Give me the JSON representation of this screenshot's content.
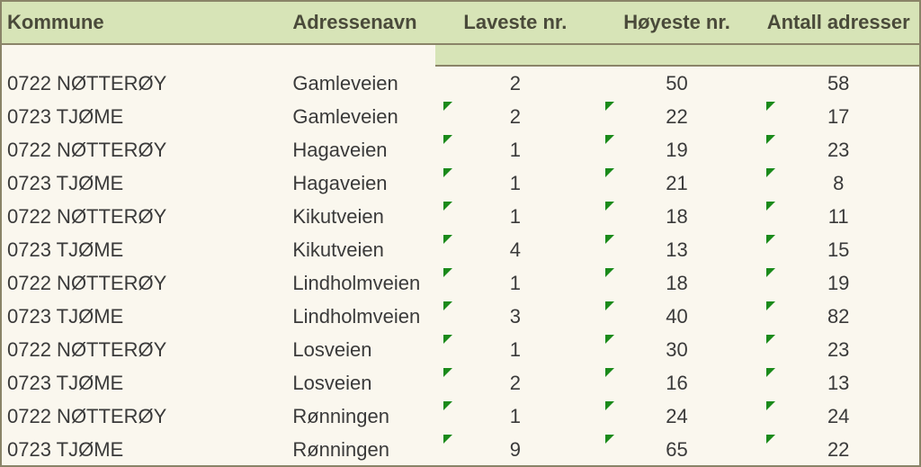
{
  "headers": {
    "kommune": "Kommune",
    "adressenavn": "Adressenavn",
    "laveste": "Laveste nr.",
    "hoyeste": "Høyeste nr.",
    "antall": "Antall adresser"
  },
  "rows": [
    {
      "kommune": "0722 NØTTERØY",
      "adressenavn": "Gamleveien",
      "laveste": "2",
      "hoyeste": "50",
      "antall": "58",
      "markers": {
        "laveste": false,
        "hoyeste": false,
        "antall": false
      }
    },
    {
      "kommune": "0723 TJØME",
      "adressenavn": "Gamleveien",
      "laveste": "2",
      "hoyeste": "22",
      "antall": "17",
      "markers": {
        "laveste": true,
        "hoyeste": true,
        "antall": true
      }
    },
    {
      "kommune": "0722 NØTTERØY",
      "adressenavn": "Hagaveien",
      "laveste": "1",
      "hoyeste": "19",
      "antall": "23",
      "markers": {
        "laveste": true,
        "hoyeste": true,
        "antall": true
      }
    },
    {
      "kommune": "0723 TJØME",
      "adressenavn": "Hagaveien",
      "laveste": "1",
      "hoyeste": "21",
      "antall": "8",
      "markers": {
        "laveste": true,
        "hoyeste": true,
        "antall": true
      }
    },
    {
      "kommune": "0722 NØTTERØY",
      "adressenavn": "Kikutveien",
      "laveste": "1",
      "hoyeste": "18",
      "antall": "11",
      "markers": {
        "laveste": true,
        "hoyeste": true,
        "antall": true
      }
    },
    {
      "kommune": "0723 TJØME",
      "adressenavn": "Kikutveien",
      "laveste": "4",
      "hoyeste": "13",
      "antall": "15",
      "markers": {
        "laveste": true,
        "hoyeste": true,
        "antall": true
      }
    },
    {
      "kommune": "0722 NØTTERØY",
      "adressenavn": "Lindholmveien",
      "laveste": "1",
      "hoyeste": "18",
      "antall": "19",
      "markers": {
        "laveste": true,
        "hoyeste": true,
        "antall": true
      }
    },
    {
      "kommune": "0723 TJØME",
      "adressenavn": "Lindholmveien",
      "laveste": "3",
      "hoyeste": "40",
      "antall": "82",
      "markers": {
        "laveste": true,
        "hoyeste": true,
        "antall": true
      }
    },
    {
      "kommune": "0722 NØTTERØY",
      "adressenavn": "Losveien",
      "laveste": "1",
      "hoyeste": "30",
      "antall": "23",
      "markers": {
        "laveste": true,
        "hoyeste": true,
        "antall": true
      }
    },
    {
      "kommune": "0723 TJØME",
      "adressenavn": "Losveien",
      "laveste": "2",
      "hoyeste": "16",
      "antall": "13",
      "markers": {
        "laveste": true,
        "hoyeste": true,
        "antall": true
      }
    },
    {
      "kommune": "0722 NØTTERØY",
      "adressenavn": "Rønningen",
      "laveste": "1",
      "hoyeste": "24",
      "antall": "24",
      "markers": {
        "laveste": true,
        "hoyeste": true,
        "antall": true
      }
    },
    {
      "kommune": "0723 TJØME",
      "adressenavn": "Rønningen",
      "laveste": "9",
      "hoyeste": "65",
      "antall": "22",
      "markers": {
        "laveste": true,
        "hoyeste": true,
        "antall": true
      }
    }
  ]
}
